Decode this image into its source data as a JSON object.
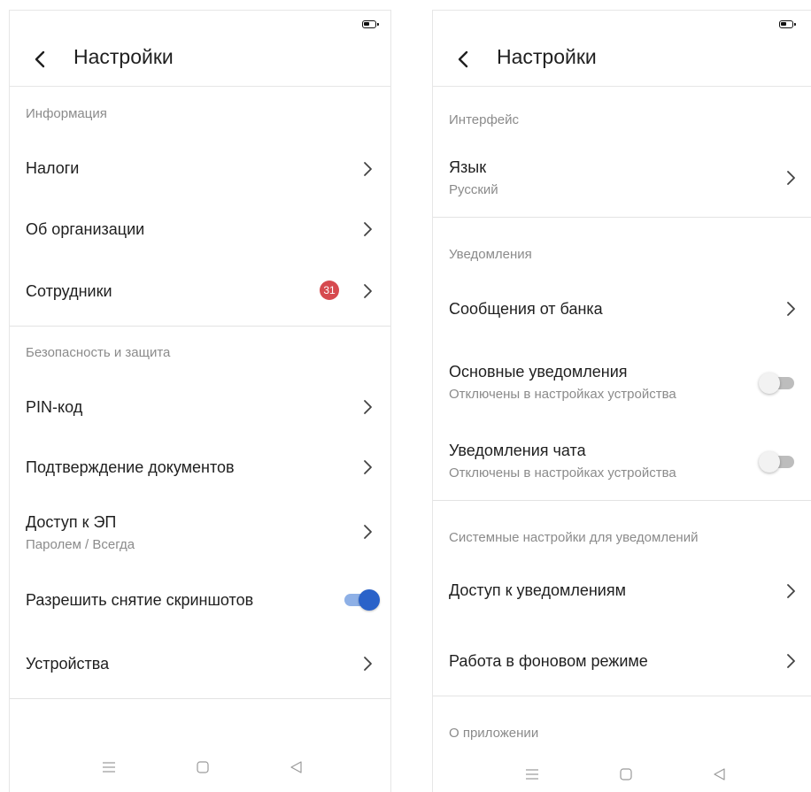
{
  "left": {
    "title": "Настройки",
    "sections": [
      {
        "header": "Информация",
        "items": [
          {
            "title": "Налоги"
          },
          {
            "title": "Об организации"
          },
          {
            "title": "Сотрудники",
            "badge": "31"
          }
        ]
      },
      {
        "header": "Безопасность и защита",
        "items": [
          {
            "title": "PIN-код"
          },
          {
            "title": "Подтверждение документов"
          },
          {
            "title": "Доступ к ЭП",
            "subtitle": "Паролем / Всегда"
          },
          {
            "title": "Разрешить снятие скриншотов",
            "toggle": true
          },
          {
            "title": "Устройства"
          }
        ]
      }
    ]
  },
  "right": {
    "title": "Настройки",
    "sections": [
      {
        "header": "Интерфейс",
        "items": [
          {
            "title": "Язык",
            "subtitle": "Русский"
          }
        ]
      },
      {
        "header": "Уведомления",
        "items": [
          {
            "title": "Сообщения от банка"
          },
          {
            "title": "Основные уведомления",
            "subtitle": "Отключены в настройках устройства",
            "toggle": false
          },
          {
            "title": "Уведомления чата",
            "subtitle": "Отключены в настройках устройства",
            "toggle": false
          }
        ]
      },
      {
        "header": "Системные настройки для уведомлений",
        "items": [
          {
            "title": "Доступ к уведомлениям"
          },
          {
            "title": "Работа в фоновом режиме"
          }
        ]
      },
      {
        "header": "О приложении",
        "items": []
      }
    ]
  },
  "colors": {
    "accent": "#2a62c9",
    "accent_track": "#8eb0e6",
    "badge": "#d64a4f",
    "secondary_text": "#8b8b8b"
  },
  "icons": [
    "back-icon",
    "chevron-right-icon",
    "battery-icon",
    "menu-icon",
    "home-icon",
    "back-nav-icon"
  ]
}
